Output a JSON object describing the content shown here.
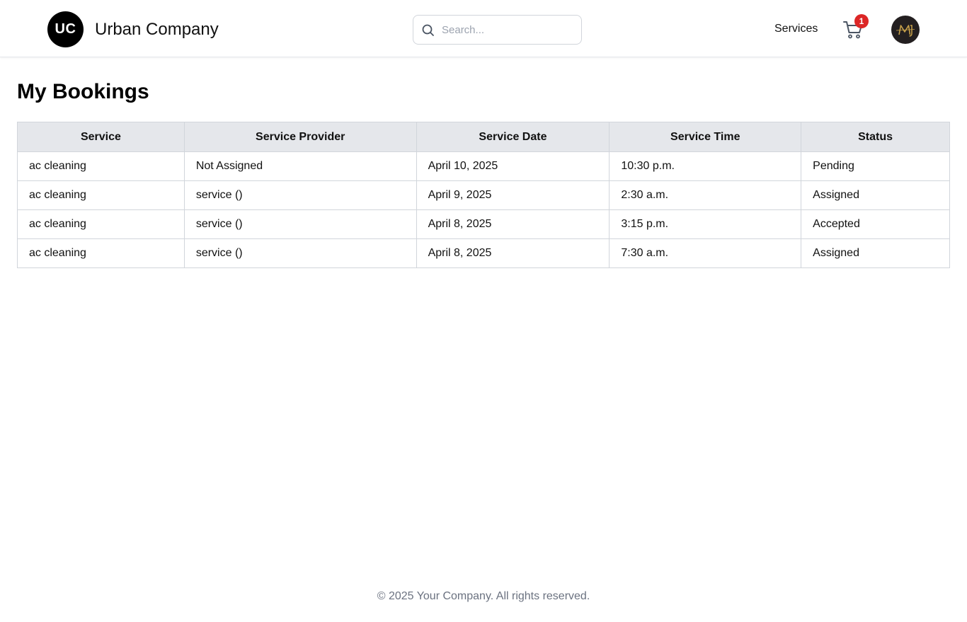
{
  "navbar": {
    "logo_text": "UC",
    "brand_name": "Urban Company",
    "search": {
      "placeholder": "Search...",
      "value": ""
    },
    "services_link": "Services",
    "cart": {
      "badge_count": "1",
      "icon": "cart-icon"
    },
    "avatar": {
      "initials": "MJ",
      "background": "#231f20",
      "accent": "#c9a24a"
    }
  },
  "page": {
    "title": "My Bookings"
  },
  "table": {
    "columns": [
      "Service",
      "Service Provider",
      "Service Date",
      "Service Time",
      "Status"
    ],
    "rows": [
      [
        "ac cleaning",
        "Not Assigned",
        "April 10, 2025",
        "10:30 p.m.",
        "Pending"
      ],
      [
        "ac cleaning",
        "service ()",
        "April 9, 2025",
        "2:30 a.m.",
        "Assigned"
      ],
      [
        "ac cleaning",
        "service ()",
        "April 8, 2025",
        "3:15 p.m.",
        "Accepted"
      ],
      [
        "ac cleaning",
        "service ()",
        "April 8, 2025",
        "7:30 a.m.",
        "Assigned"
      ]
    ]
  },
  "footer": {
    "text": "© 2025 Your Company. All rights reserved."
  },
  "colors": {
    "header_bg": "#e5e7eb",
    "border": "#d1d5db",
    "badge": "#dc2626",
    "footer_text": "#6b7280"
  }
}
